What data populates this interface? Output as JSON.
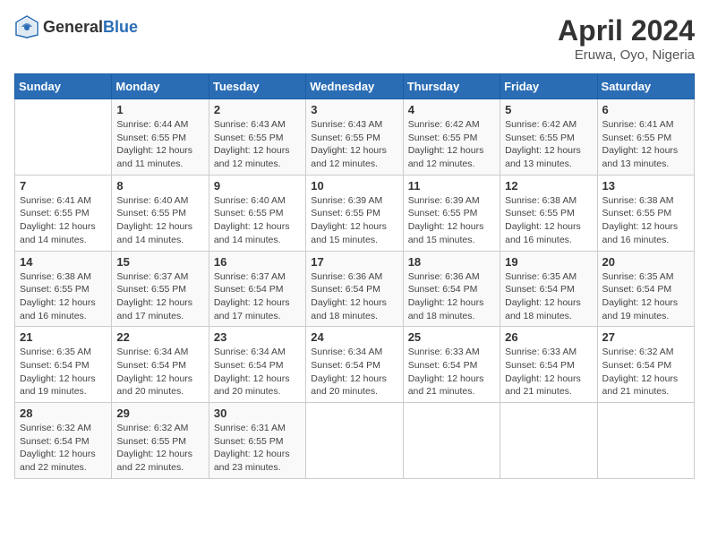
{
  "header": {
    "logo_general": "General",
    "logo_blue": "Blue",
    "title": "April 2024",
    "subtitle": "Eruwa, Oyo, Nigeria"
  },
  "calendar": {
    "weekdays": [
      "Sunday",
      "Monday",
      "Tuesday",
      "Wednesday",
      "Thursday",
      "Friday",
      "Saturday"
    ],
    "weeks": [
      [
        {
          "day": "",
          "info": ""
        },
        {
          "day": "1",
          "info": "Sunrise: 6:44 AM\nSunset: 6:55 PM\nDaylight: 12 hours and 11 minutes."
        },
        {
          "day": "2",
          "info": "Sunrise: 6:43 AM\nSunset: 6:55 PM\nDaylight: 12 hours and 12 minutes."
        },
        {
          "day": "3",
          "info": "Sunrise: 6:43 AM\nSunset: 6:55 PM\nDaylight: 12 hours and 12 minutes."
        },
        {
          "day": "4",
          "info": "Sunrise: 6:42 AM\nSunset: 6:55 PM\nDaylight: 12 hours and 12 minutes."
        },
        {
          "day": "5",
          "info": "Sunrise: 6:42 AM\nSunset: 6:55 PM\nDaylight: 12 hours and 13 minutes."
        },
        {
          "day": "6",
          "info": "Sunrise: 6:41 AM\nSunset: 6:55 PM\nDaylight: 12 hours and 13 minutes."
        }
      ],
      [
        {
          "day": "7",
          "info": "Sunrise: 6:41 AM\nSunset: 6:55 PM\nDaylight: 12 hours and 14 minutes."
        },
        {
          "day": "8",
          "info": "Sunrise: 6:40 AM\nSunset: 6:55 PM\nDaylight: 12 hours and 14 minutes."
        },
        {
          "day": "9",
          "info": "Sunrise: 6:40 AM\nSunset: 6:55 PM\nDaylight: 12 hours and 14 minutes."
        },
        {
          "day": "10",
          "info": "Sunrise: 6:39 AM\nSunset: 6:55 PM\nDaylight: 12 hours and 15 minutes."
        },
        {
          "day": "11",
          "info": "Sunrise: 6:39 AM\nSunset: 6:55 PM\nDaylight: 12 hours and 15 minutes."
        },
        {
          "day": "12",
          "info": "Sunrise: 6:38 AM\nSunset: 6:55 PM\nDaylight: 12 hours and 16 minutes."
        },
        {
          "day": "13",
          "info": "Sunrise: 6:38 AM\nSunset: 6:55 PM\nDaylight: 12 hours and 16 minutes."
        }
      ],
      [
        {
          "day": "14",
          "info": "Sunrise: 6:38 AM\nSunset: 6:55 PM\nDaylight: 12 hours and 16 minutes."
        },
        {
          "day": "15",
          "info": "Sunrise: 6:37 AM\nSunset: 6:55 PM\nDaylight: 12 hours and 17 minutes."
        },
        {
          "day": "16",
          "info": "Sunrise: 6:37 AM\nSunset: 6:54 PM\nDaylight: 12 hours and 17 minutes."
        },
        {
          "day": "17",
          "info": "Sunrise: 6:36 AM\nSunset: 6:54 PM\nDaylight: 12 hours and 18 minutes."
        },
        {
          "day": "18",
          "info": "Sunrise: 6:36 AM\nSunset: 6:54 PM\nDaylight: 12 hours and 18 minutes."
        },
        {
          "day": "19",
          "info": "Sunrise: 6:35 AM\nSunset: 6:54 PM\nDaylight: 12 hours and 18 minutes."
        },
        {
          "day": "20",
          "info": "Sunrise: 6:35 AM\nSunset: 6:54 PM\nDaylight: 12 hours and 19 minutes."
        }
      ],
      [
        {
          "day": "21",
          "info": "Sunrise: 6:35 AM\nSunset: 6:54 PM\nDaylight: 12 hours and 19 minutes."
        },
        {
          "day": "22",
          "info": "Sunrise: 6:34 AM\nSunset: 6:54 PM\nDaylight: 12 hours and 20 minutes."
        },
        {
          "day": "23",
          "info": "Sunrise: 6:34 AM\nSunset: 6:54 PM\nDaylight: 12 hours and 20 minutes."
        },
        {
          "day": "24",
          "info": "Sunrise: 6:34 AM\nSunset: 6:54 PM\nDaylight: 12 hours and 20 minutes."
        },
        {
          "day": "25",
          "info": "Sunrise: 6:33 AM\nSunset: 6:54 PM\nDaylight: 12 hours and 21 minutes."
        },
        {
          "day": "26",
          "info": "Sunrise: 6:33 AM\nSunset: 6:54 PM\nDaylight: 12 hours and 21 minutes."
        },
        {
          "day": "27",
          "info": "Sunrise: 6:32 AM\nSunset: 6:54 PM\nDaylight: 12 hours and 21 minutes."
        }
      ],
      [
        {
          "day": "28",
          "info": "Sunrise: 6:32 AM\nSunset: 6:54 PM\nDaylight: 12 hours and 22 minutes."
        },
        {
          "day": "29",
          "info": "Sunrise: 6:32 AM\nSunset: 6:55 PM\nDaylight: 12 hours and 22 minutes."
        },
        {
          "day": "30",
          "info": "Sunrise: 6:31 AM\nSunset: 6:55 PM\nDaylight: 12 hours and 23 minutes."
        },
        {
          "day": "",
          "info": ""
        },
        {
          "day": "",
          "info": ""
        },
        {
          "day": "",
          "info": ""
        },
        {
          "day": "",
          "info": ""
        }
      ]
    ]
  }
}
